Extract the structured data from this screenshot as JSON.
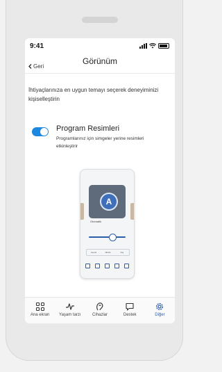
{
  "status_bar": {
    "time": "9:41"
  },
  "header": {
    "back_label": "Geri",
    "title": "Görünüm"
  },
  "description": "İhtiyaçlarınıza en uygun temayı seçerek deneyiminizi kişiselleştirin",
  "setting": {
    "title": "Program Resimleri",
    "subtitle": "Programlarınız için simgeler yerine resimleri etkinleştirir",
    "enabled": true
  },
  "preview": {
    "avatar_letter": "A",
    "mode_label": "Otomatik",
    "segments": [
      "Genel",
      "Müzik",
      "Dış"
    ]
  },
  "tabs": [
    {
      "label": "Ana ekran",
      "icon": "grid-icon"
    },
    {
      "label": "Yaşam tarzı",
      "icon": "pulse-icon"
    },
    {
      "label": "Cihazlar",
      "icon": "hearing-aid-icon"
    },
    {
      "label": "Destek",
      "icon": "chat-icon"
    },
    {
      "label": "Diğer",
      "icon": "gear-icon",
      "active": true
    }
  ],
  "colors": {
    "accent": "#1c88e0",
    "active_tab": "#2b5ea9"
  }
}
